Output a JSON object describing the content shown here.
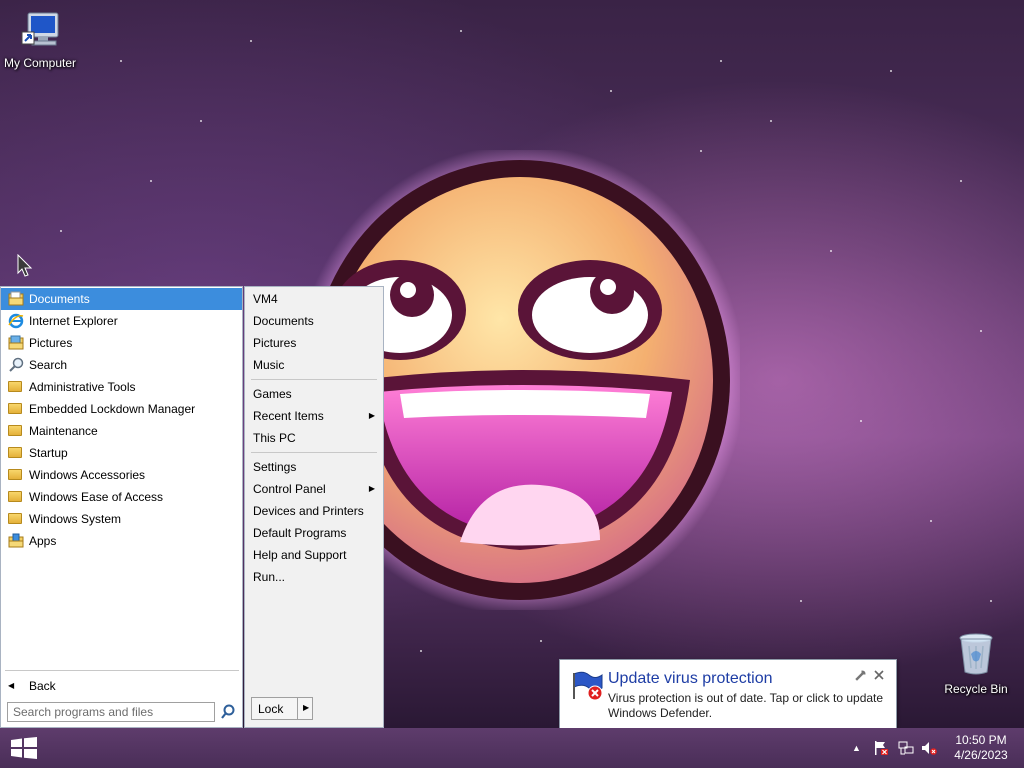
{
  "desktop": {
    "icons": [
      {
        "label": "My Computer",
        "icon": "computer-icon"
      },
      {
        "label": "Recycle Bin",
        "icon": "recycle-bin-icon"
      }
    ]
  },
  "start_menu": {
    "programs": [
      {
        "label": "Documents",
        "icon": "documents-folder-icon",
        "selected": true
      },
      {
        "label": "Internet Explorer",
        "icon": "internet-explorer-icon"
      },
      {
        "label": "Pictures",
        "icon": "pictures-icon"
      },
      {
        "label": "Search",
        "icon": "search-icon"
      },
      {
        "label": "Administrative Tools",
        "icon": "folder-icon"
      },
      {
        "label": "Embedded Lockdown Manager",
        "icon": "folder-icon"
      },
      {
        "label": "Maintenance",
        "icon": "folder-icon"
      },
      {
        "label": "Startup",
        "icon": "folder-icon"
      },
      {
        "label": "Windows Accessories",
        "icon": "folder-icon"
      },
      {
        "label": "Windows Ease of Access",
        "icon": "folder-icon"
      },
      {
        "label": "Windows System",
        "icon": "folder-icon"
      },
      {
        "label": "Apps",
        "icon": "apps-icon"
      }
    ],
    "back_label": "Back",
    "search_placeholder": "Search programs and files",
    "right_groups": [
      [
        {
          "label": "VM4"
        },
        {
          "label": "Documents"
        },
        {
          "label": "Pictures"
        },
        {
          "label": "Music"
        }
      ],
      [
        {
          "label": "Games"
        },
        {
          "label": "Recent Items",
          "submenu": true
        },
        {
          "label": "This PC"
        }
      ],
      [
        {
          "label": "Settings"
        },
        {
          "label": "Control Panel",
          "submenu": true
        },
        {
          "label": "Devices and Printers"
        },
        {
          "label": "Default Programs"
        },
        {
          "label": "Help and Support"
        },
        {
          "label": "Run..."
        }
      ]
    ],
    "lock_label": "Lock"
  },
  "notification": {
    "title": "Update virus protection",
    "body": "Virus protection is out of date. Tap or click to update Windows Defender."
  },
  "taskbar": {
    "time": "10:50 PM",
    "date": "4/26/2023"
  },
  "colors": {
    "selection": "#3c8ddd",
    "taskbar": "#4a2e58",
    "notification_title": "#1e3da5"
  }
}
